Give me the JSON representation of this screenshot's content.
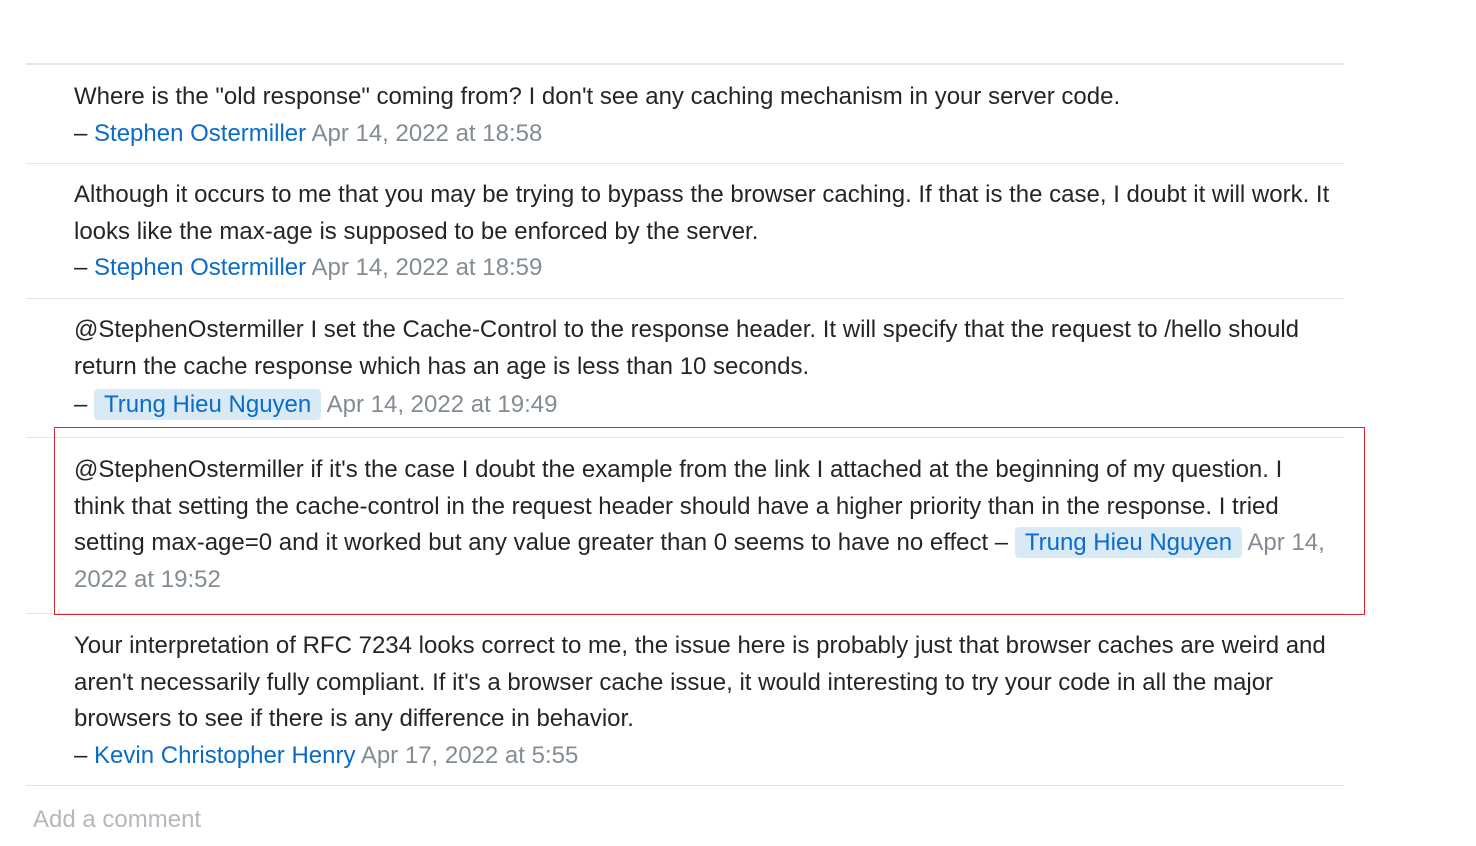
{
  "comments": [
    {
      "text": "Where is the \"old response\" coming from? I don't see any caching mechanism in your server code.",
      "dash": "–",
      "user": "Stephen Ostermiller",
      "date": "Apr 14, 2022 at 18:58"
    },
    {
      "text": "Although it occurs to me that you may be trying to bypass the browser caching. If that is the case, I doubt it will work. It looks like the max-age is supposed to be enforced by the server.",
      "dash": "–",
      "user": "Stephen Ostermiller",
      "date": "Apr 14, 2022 at 18:59"
    },
    {
      "text": "@StephenOstermiller I set the Cache-Control to the response header. It will specify that the request to /hello should return the cache response which has an age is less than 10 seconds.",
      "dash": "–",
      "user": "Trung Hieu Nguyen",
      "date": "Apr 14, 2022 at 19:49"
    },
    {
      "text": "@StephenOstermiller if it's the case I doubt the example from the link I attached at the beginning of my question. I think that setting the cache-control in the request header should have a higher priority than in the response. I tried setting max-age=0 and it worked but any value greater than 0 seems to have no effect",
      "dash": "–",
      "user": "Trung Hieu Nguyen",
      "date": "Apr 14, 2022 at 19:52"
    },
    {
      "text": "Your interpretation of RFC 7234 looks correct to me, the issue here is probably just that browser caches are weird and aren't necessarily fully compliant. If it's a browser cache issue, it would interesting to try your code in all the major browsers to see if there is any difference in behavior.",
      "dash": "–",
      "user": "Kevin Christopher Henry",
      "date": "Apr 17, 2022 at 5:55"
    }
  ],
  "add_comment_label": "Add a comment",
  "colors": {
    "link": "#0a6bc8",
    "op_badge_bg": "#d9eaf7",
    "date": "#838c95",
    "highlight_border": "#d7262c"
  }
}
